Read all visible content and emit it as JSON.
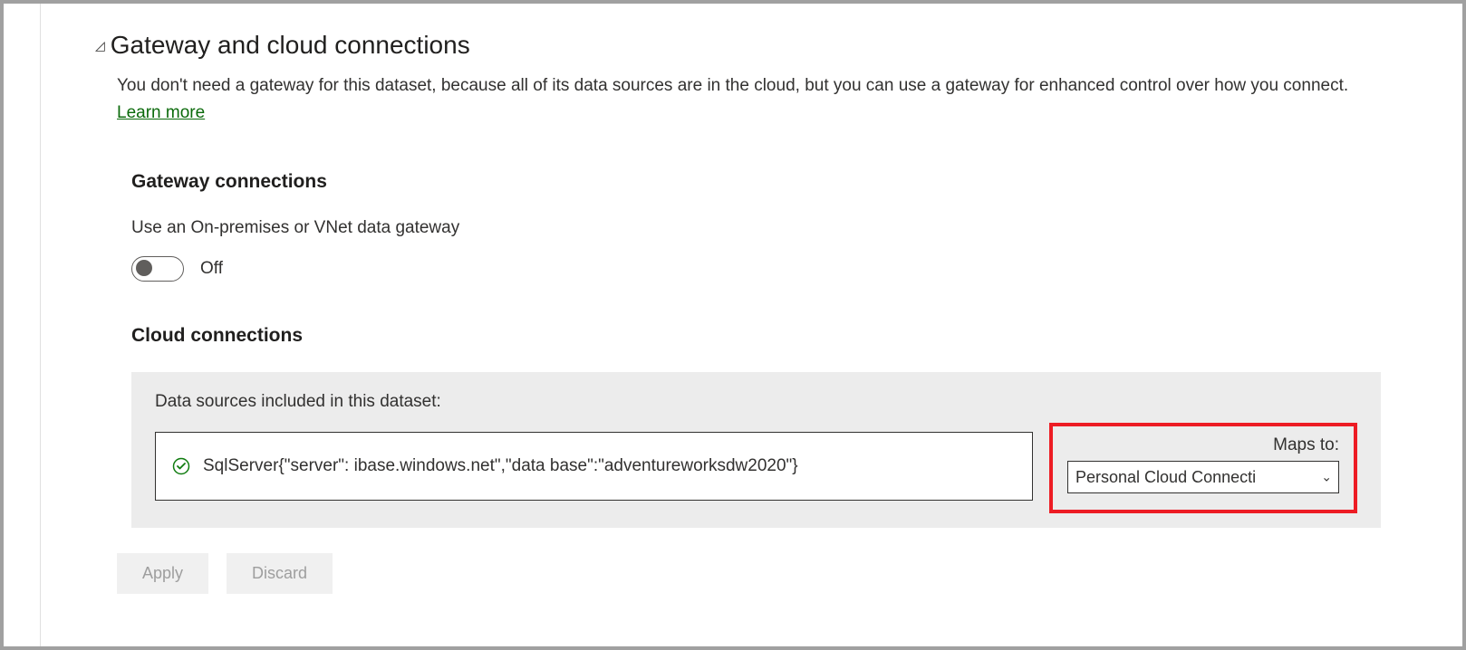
{
  "section": {
    "title": "Gateway and cloud connections",
    "description_pre": "You don't need a gateway for this dataset, because all of its data sources are in the cloud, but you can use a gateway for enhanced control over how you connect. ",
    "learn_more": "Learn more"
  },
  "gateway": {
    "title": "Gateway connections",
    "label": "Use an On-premises or VNet data gateway",
    "toggle_state": "Off"
  },
  "cloud": {
    "title": "Cloud connections",
    "panel_label": "Data sources included in this dataset:",
    "source_text": "SqlServer{\"server\":                        ibase.windows.net\",\"data base\":\"adventureworksdw2020\"}",
    "maps_to_label": "Maps to:",
    "maps_to_value": "Personal Cloud Connecti"
  },
  "buttons": {
    "apply": "Apply",
    "discard": "Discard"
  }
}
